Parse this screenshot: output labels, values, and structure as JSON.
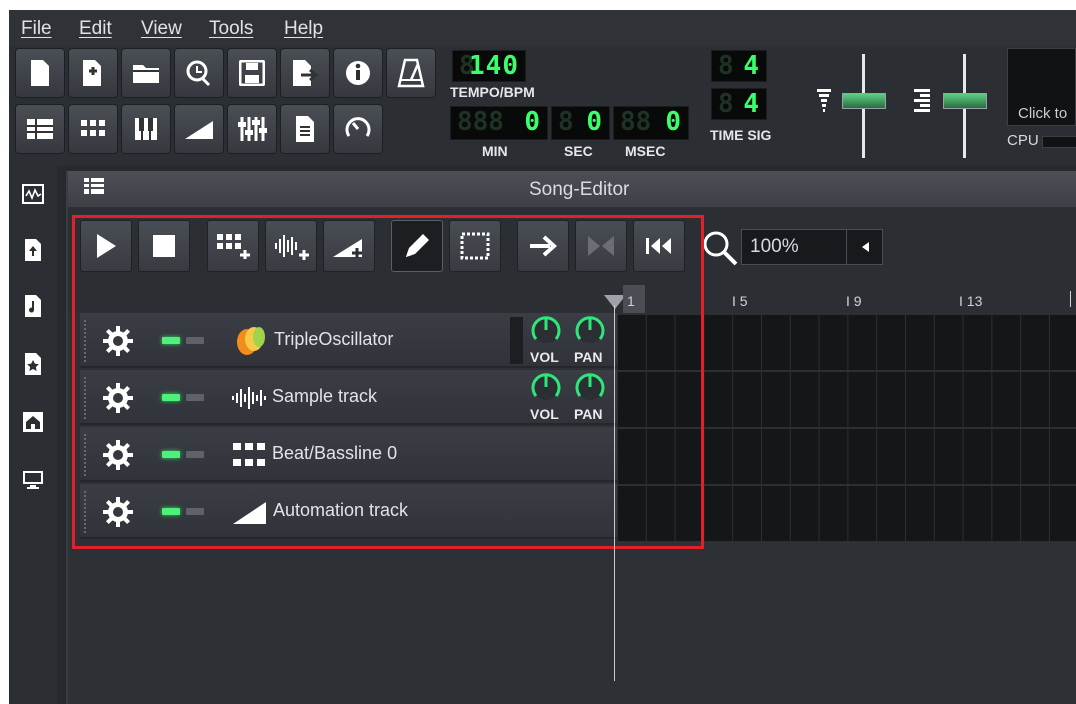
{
  "menu": [
    "File",
    "Edit",
    "View",
    "Tools",
    "Help"
  ],
  "transport": {
    "tempo_value": "140",
    "tempo_label": "TEMPO/BPM",
    "min_value": "0",
    "sec_value": "0",
    "msec_value": "0",
    "min_label": "MIN",
    "sec_label": "SEC",
    "msec_label": "MSEC",
    "timesig_num": "4",
    "timesig_den": "4",
    "timesig_label": "TIME SIG",
    "click_text": "Click to",
    "cpu_label": "CPU"
  },
  "song_editor": {
    "title": "Song-Editor",
    "zoom_value": "100%",
    "ruler_labels": [
      "1",
      "5",
      "9",
      "13"
    ],
    "tracks": [
      {
        "name": "TripleOscillator",
        "vol_label": "VOL",
        "pan_label": "PAN"
      },
      {
        "name": "Sample track",
        "vol_label": "VOL",
        "pan_label": "PAN"
      },
      {
        "name": "Beat/Bassline 0"
      },
      {
        "name": "Automation track"
      }
    ]
  },
  "colors": {
    "lcd_green": "#38ff6a",
    "highlight_red": "#e0202a",
    "led_green": "#4cf07a"
  }
}
